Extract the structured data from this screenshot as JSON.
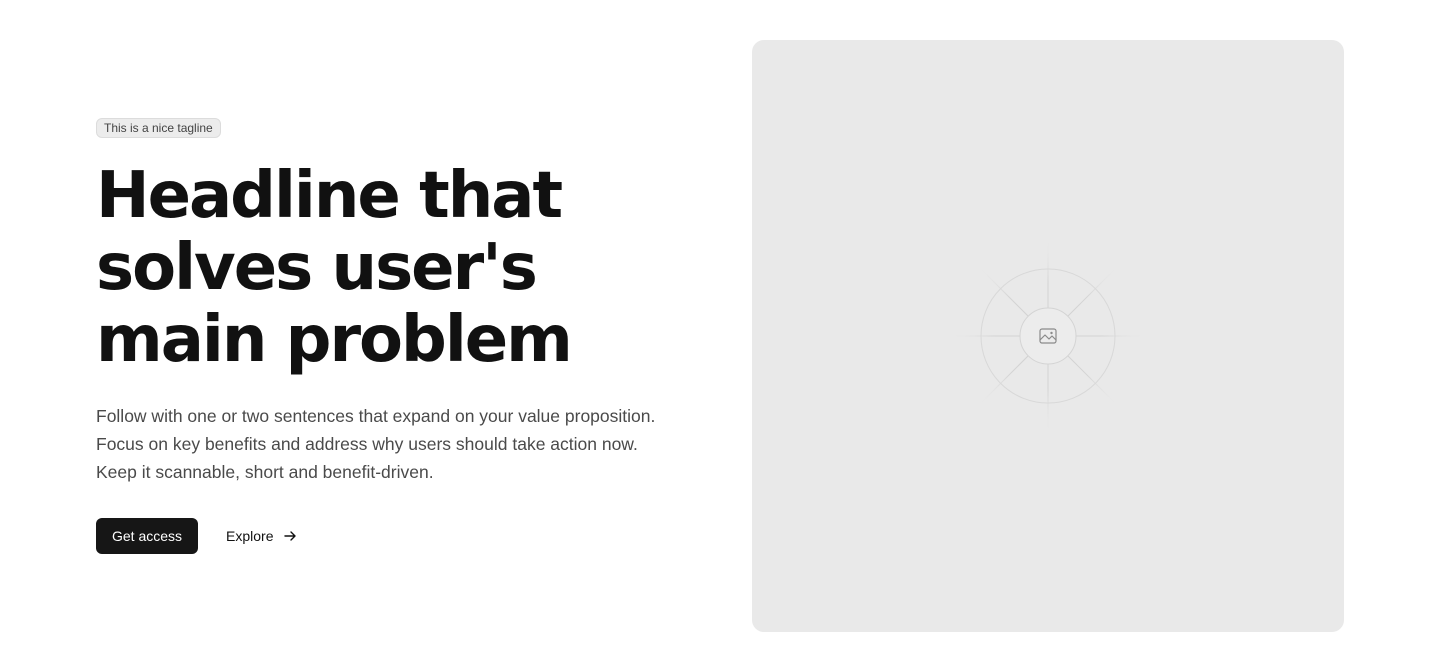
{
  "hero": {
    "tagline": "This is a nice tagline",
    "headline": "Headline that solves user's main problem",
    "description_lines": [
      "Follow with one or two sentences that expand on your value proposition.",
      "Focus on key benefits and address why users should take action now.",
      "Keep it scannable, short and benefit-driven."
    ],
    "primary_cta": "Get access",
    "secondary_cta": "Explore"
  },
  "media": {
    "icon": "image-icon"
  },
  "colors": {
    "background": "#ffffff",
    "primary_button": "#161616",
    "media_background": "#e9e9e9",
    "tagline_background": "#ececec",
    "body_text": "#4a4a4a"
  },
  "icons": {
    "explore_arrow": "arrow-right-icon",
    "media_placeholder": "image-icon"
  }
}
